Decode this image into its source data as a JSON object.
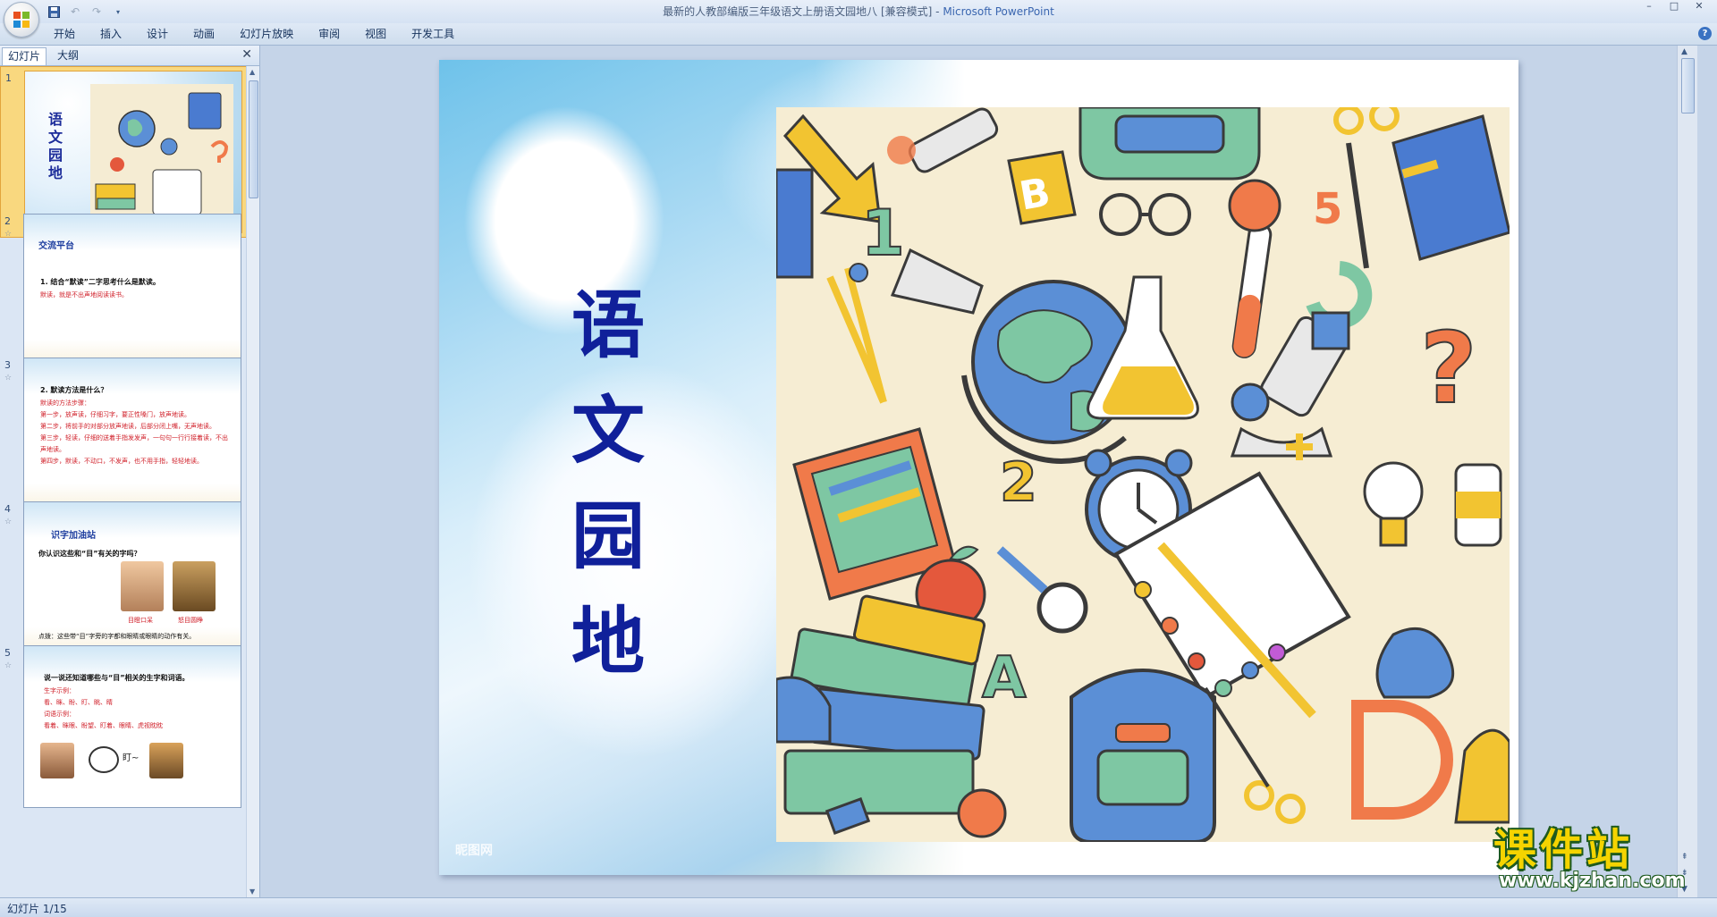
{
  "window": {
    "title": "最新的人教部编版三年级语文上册语文园地八 [兼容模式]",
    "app_name": "Microsoft PowerPoint",
    "controls": [
      "–",
      "□",
      "✕"
    ]
  },
  "quick_access": {
    "save_icon": "save-icon",
    "undo_icon": "undo-icon",
    "redo_icon": "redo-icon"
  },
  "ribbon": {
    "tabs": [
      "开始",
      "插入",
      "设计",
      "动画",
      "幻灯片放映",
      "审阅",
      "视图",
      "开发工具"
    ],
    "help": "?"
  },
  "left_pane": {
    "tabs": [
      "幻灯片",
      "大纲"
    ],
    "close": "✕",
    "thumbnails": [
      {
        "number": "1",
        "title": "语文园地"
      },
      {
        "number": "2",
        "heading": "交流平台",
        "question": "1. 结合“默读”二字思考什么是默读。",
        "answer": "默读，就是不出声地阅读读书。"
      },
      {
        "number": "3",
        "question": "2. 默读方法是什么？",
        "lines": [
          "默读的方法步骤：",
          "第一步，放声读，仔细习字，要正性嗓门，放声地读。",
          "第二步，将前手的对部分放声地读，后部分闭上嘴，无声地读。",
          "第三步，轻读，仔细的送着手指发发声，一句句一行行接着读，不出声地读。",
          "第四步，默读，不动口，不发声，也不用手指，轻轻地读。"
        ]
      },
      {
        "number": "4",
        "heading": "识字加油站",
        "question": "你认识这些和“目”有关的字吗？",
        "captions": [
          "目瞪口呆",
          "怒目圆睁"
        ],
        "note": "点拨：这些带“目”字旁的字都和眼睛或眼睛的动作有关。"
      },
      {
        "number": "5",
        "question": "说一说还知道哪些与“目”相关的生字和词语。",
        "lines": [
          "生字示例：",
          "看、眯、盼、盯、眺、睛",
          "词语示例：",
          "看着、眯眼、盼望、盯着、眼睛、虎视眈眈"
        ],
        "bubble": "盯~"
      }
    ]
  },
  "slide": {
    "title": "语文园地",
    "title_chars": [
      "语",
      "文",
      "园",
      "地"
    ],
    "small_watermark": "昵图网",
    "art_description_icons": [
      "arrow",
      "flashlight",
      "backpack",
      "scissors",
      "book",
      "number-1",
      "letter-b",
      "glasses",
      "globe",
      "test-tube",
      "flask",
      "microscope",
      "question-mark",
      "compass",
      "pencil-case",
      "alarm-clock",
      "paint-palette",
      "light-bulb",
      "apple",
      "magnifier",
      "letter-a",
      "books",
      "shoe",
      "ruler",
      "bell",
      "glue",
      "letter-c",
      "number-2",
      "number-5"
    ]
  },
  "status_bar": {
    "slide_info": "幻灯片 1/15"
  },
  "site_watermark": {
    "name": "课件站",
    "url": "www.kjzhan.com"
  },
  "colors": {
    "title_blue": "#10209a",
    "selection": "#f9d87f",
    "ribbon": "#dfe9f6",
    "watermark_yellow": "#f5d400"
  }
}
